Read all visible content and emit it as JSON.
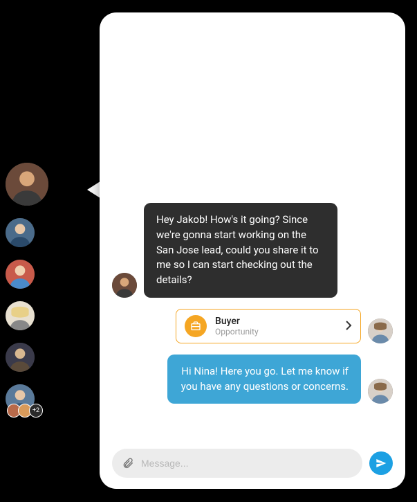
{
  "sidebar": {
    "active_contact": "nina",
    "contacts": [
      {
        "id": "nina"
      },
      {
        "id": "contact2"
      },
      {
        "id": "contact3"
      },
      {
        "id": "contact4"
      },
      {
        "id": "contact5"
      }
    ],
    "group": {
      "more_count": "+2"
    }
  },
  "chat": {
    "messages": [
      {
        "sender": "nina",
        "text": "Hey Jakob! How's it going? Since we're gonna start working on the San Jose lead, could you share it to me so I can start checking out the details?"
      },
      {
        "sender": "jakob",
        "text": "Hi Nina! Here you go. Let me know if you have any questions or concerns."
      }
    ],
    "card": {
      "title": "Buyer",
      "subtitle": "Opportunity",
      "icon": "briefcase-icon",
      "accent": "#f5a623"
    }
  },
  "composer": {
    "placeholder": "Message...",
    "value": ""
  }
}
